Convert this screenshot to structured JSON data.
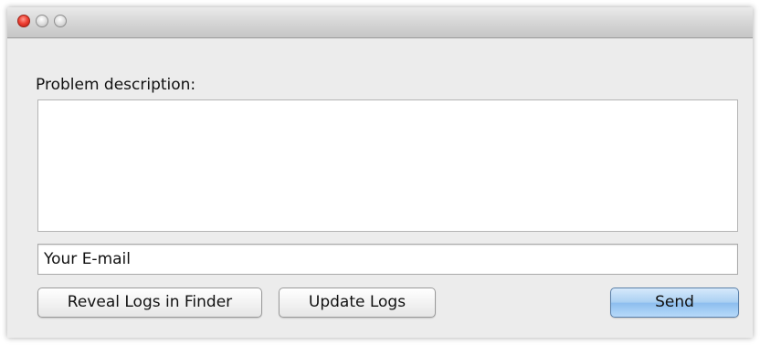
{
  "window": {
    "controls": [
      "close-icon",
      "minimize-icon",
      "zoom-icon"
    ],
    "close_color": "#ef4336"
  },
  "form": {
    "description_label": "Problem description:",
    "description_value": "",
    "email_value": "Your E-mail"
  },
  "buttons": {
    "reveal_logs": "Reveal Logs in Finder",
    "update_logs": "Update Logs",
    "send": "Send"
  },
  "colors": {
    "window_bg": "#ececec",
    "default_button_accent": "#9fc8f2"
  }
}
